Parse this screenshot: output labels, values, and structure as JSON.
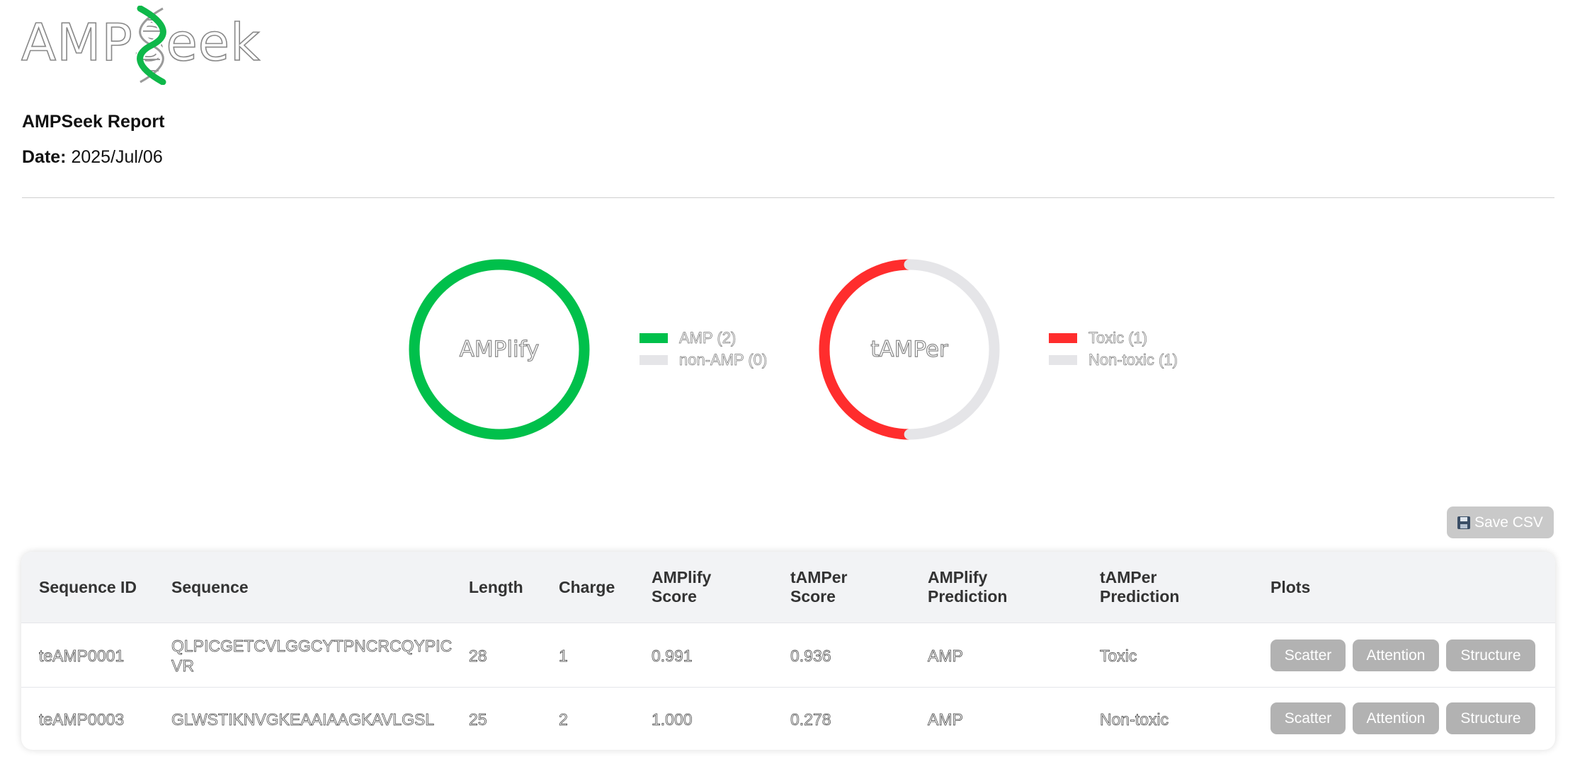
{
  "app": {
    "logo_text": "AMPSeek",
    "report_title": "AMPSeek Report",
    "date_label": "Date:",
    "date_value": "2025/Jul/06"
  },
  "charts_section": {
    "amplify": {
      "center_label": "AMPlify",
      "legend": [
        {
          "label": "AMP (2)",
          "color": "#00c04b"
        },
        {
          "label": "non-AMP (0)",
          "color": "#e5e5e8"
        }
      ]
    },
    "tamper": {
      "center_label": "tAMPer",
      "legend": [
        {
          "label": "Toxic (1)",
          "color": "#ff2d2d"
        },
        {
          "label": "Non-toxic (1)",
          "color": "#e5e5e8"
        }
      ]
    }
  },
  "chart_data": [
    {
      "type": "pie",
      "title": "AMPlify",
      "categories": [
        "AMP",
        "non-AMP"
      ],
      "values": [
        2,
        0
      ],
      "colors": [
        "#00c04b",
        "#e5e5e8"
      ],
      "legend_placement": "right"
    },
    {
      "type": "pie",
      "title": "tAMPer",
      "categories": [
        "Toxic",
        "Non-toxic"
      ],
      "values": [
        1,
        1
      ],
      "colors": [
        "#ff2d2d",
        "#e5e5e8"
      ],
      "legend_placement": "right"
    }
  ],
  "toolbar": {
    "save_label": "Save CSV",
    "save_icon": "floppy-disk-icon"
  },
  "table": {
    "headers": {
      "seq_id": "Sequence ID",
      "sequence": "Sequence",
      "length": "Length",
      "charge": "Charge",
      "amplify_score": "AMPlify Score",
      "tamper_score": "tAMPer Score",
      "amplify_prediction": "AMPlify Prediction",
      "tamper_prediction": "tAMPer Prediction",
      "plots": "Plots"
    },
    "rows": [
      {
        "seq_id": "teAMP0001",
        "sequence": "QLPICGETCVLGGCYTPNCRCQYPICVR",
        "length": "28",
        "charge": "1",
        "amplify_score": "0.991",
        "tamper_score": "0.936",
        "amplify_prediction": "AMP",
        "tamper_prediction": "Toxic"
      },
      {
        "seq_id": "teAMP0003",
        "sequence": "GLWSTIKNVGKEAAIAAGKAVLGSL",
        "length": "25",
        "charge": "2",
        "amplify_score": "1.000",
        "tamper_score": "0.278",
        "amplify_prediction": "AMP",
        "tamper_prediction": "Non-toxic"
      }
    ],
    "plot_buttons": {
      "scatter": "Scatter",
      "attention": "Attention",
      "structure": "Structure"
    }
  }
}
